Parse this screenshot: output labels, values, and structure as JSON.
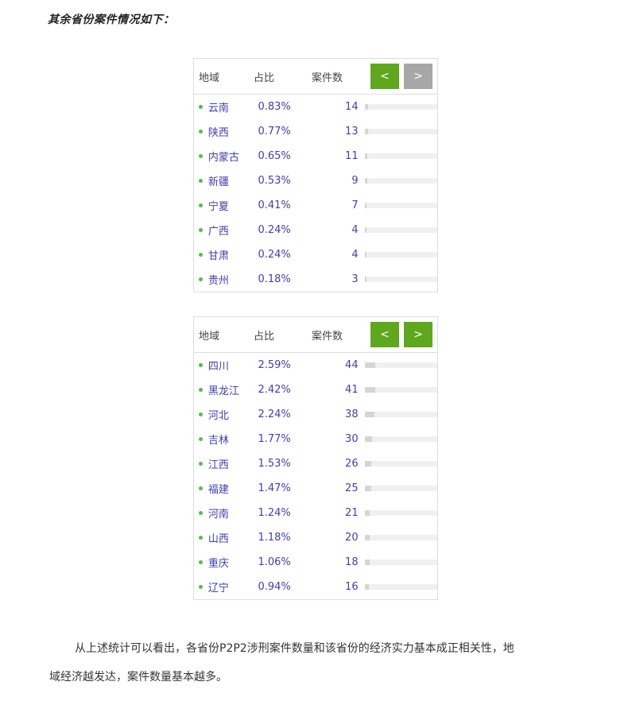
{
  "heading": "其余省份案件情况如下：",
  "tables": [
    {
      "headers": {
        "region": "地域",
        "pct": "占比",
        "count": "案件数"
      },
      "prev_label": "<",
      "next_label": ">",
      "prev_active": true,
      "next_active": false,
      "rows": [
        {
          "name": "云南",
          "pct": "0.83%",
          "count": "14",
          "value": 14
        },
        {
          "name": "陕西",
          "pct": "0.77%",
          "count": "13",
          "value": 13
        },
        {
          "name": "内蒙古",
          "pct": "0.65%",
          "count": "11",
          "value": 11
        },
        {
          "name": "新疆",
          "pct": "0.53%",
          "count": "9",
          "value": 9
        },
        {
          "name": "宁夏",
          "pct": "0.41%",
          "count": "7",
          "value": 7
        },
        {
          "name": "广西",
          "pct": "0.24%",
          "count": "4",
          "value": 4
        },
        {
          "name": "甘肃",
          "pct": "0.24%",
          "count": "4",
          "value": 4
        },
        {
          "name": "贵州",
          "pct": "0.18%",
          "count": "3",
          "value": 3
        }
      ]
    },
    {
      "headers": {
        "region": "地域",
        "pct": "占比",
        "count": "案件数"
      },
      "prev_label": "<",
      "next_label": ">",
      "prev_active": true,
      "next_active": true,
      "rows": [
        {
          "name": "四川",
          "pct": "2.59%",
          "count": "44",
          "value": 44
        },
        {
          "name": "黑龙江",
          "pct": "2.42%",
          "count": "41",
          "value": 41
        },
        {
          "name": "河北",
          "pct": "2.24%",
          "count": "38",
          "value": 38
        },
        {
          "name": "吉林",
          "pct": "1.77%",
          "count": "30",
          "value": 30
        },
        {
          "name": "江西",
          "pct": "1.53%",
          "count": "26",
          "value": 26
        },
        {
          "name": "福建",
          "pct": "1.47%",
          "count": "25",
          "value": 25
        },
        {
          "name": "河南",
          "pct": "1.24%",
          "count": "21",
          "value": 21
        },
        {
          "name": "山西",
          "pct": "1.18%",
          "count": "20",
          "value": 20
        },
        {
          "name": "重庆",
          "pct": "1.06%",
          "count": "18",
          "value": 18
        },
        {
          "name": "辽宁",
          "pct": "0.94%",
          "count": "16",
          "value": 16
        }
      ]
    }
  ],
  "paragraph": {
    "line1": "从上述统计可以看出，各省份P2P2涉刑案件数量和该省份的经济实力基本成正相关性，地",
    "line2": "域经济越发达，案件数量基本越多。"
  },
  "colors": {
    "button_active": "#5fa71d",
    "button_inactive": "#a7a7a7",
    "row_text": "#3f3eb4",
    "dot": "#4fbf4f"
  }
}
